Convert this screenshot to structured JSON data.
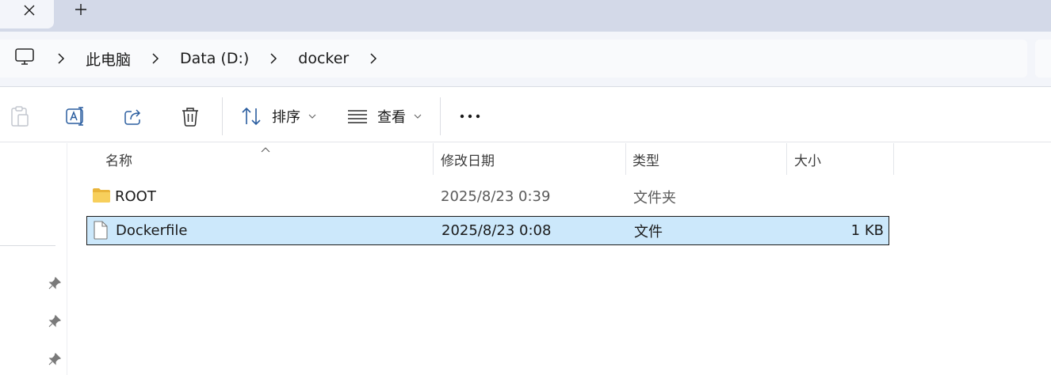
{
  "tab": {
    "close_glyph": "✕",
    "new_glyph": "+"
  },
  "breadcrumb": {
    "root_icon": "computer-icon",
    "items": [
      "此电脑",
      "Data (D:)",
      "docker"
    ]
  },
  "toolbar": {
    "paste_icon": "clipboard-icon",
    "rename_icon": "rename-icon",
    "share_icon": "share-icon",
    "delete_icon": "trash-icon",
    "sort_label": "排序",
    "view_label": "查看",
    "more_glyph": "•••"
  },
  "columns": {
    "name": "名称",
    "date": "修改日期",
    "type": "类型",
    "size": "大小"
  },
  "files": [
    {
      "name": "ROOT",
      "date": "2025/8/23 0:39",
      "type": "文件夹",
      "size": "",
      "icon": "folder-icon",
      "selected": false
    },
    {
      "name": "Dockerfile",
      "date": "2025/8/23 0:08",
      "type": "文件",
      "size": "1 KB",
      "icon": "file-icon",
      "selected": true
    }
  ],
  "colors": {
    "accent_selection": "#cce8fb",
    "tabstrip": "#d3d9e8",
    "folder": "#f2c94c"
  }
}
